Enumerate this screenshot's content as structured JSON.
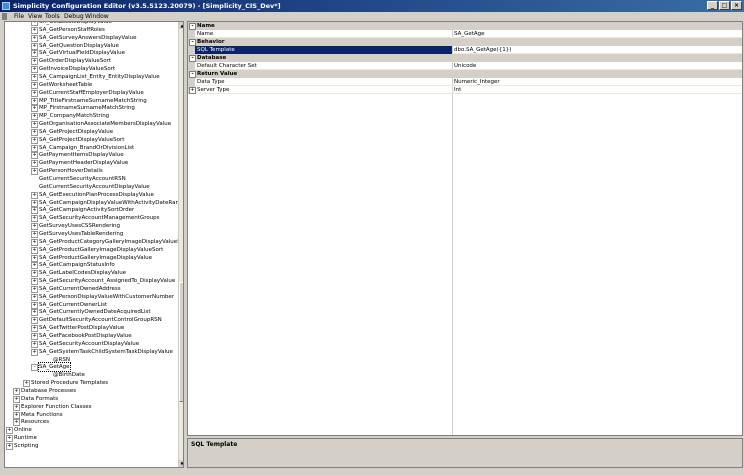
{
  "window": {
    "title": "Simplicity Configuration Editor (v3.5.5123.20079) - [Simplicity_CIS_Dev*]"
  },
  "menu": [
    "File",
    "View",
    "Tools",
    "Debug",
    "Window"
  ],
  "tree": [
    {
      "label": "SA_GetLocaleDisplayValue",
      "indent": 2,
      "exp": "+"
    },
    {
      "label": "SA_GetPersonStaffRoles",
      "indent": 2,
      "exp": "+"
    },
    {
      "label": "SA_GetSurveyAnswersDisplayValue",
      "indent": 2,
      "exp": "+"
    },
    {
      "label": "SA_GetQuestionDisplayValue",
      "indent": 2,
      "exp": "+"
    },
    {
      "label": "SA_GetVirtualFieldDisplayValue",
      "indent": 2,
      "exp": "+"
    },
    {
      "label": "GetOrderDisplayValueSort",
      "indent": 2,
      "exp": "+"
    },
    {
      "label": "GetInvoiceDisplayValueSort",
      "indent": 2,
      "exp": "+"
    },
    {
      "label": "SA_CampaignList_Entity_EntityDisplayValue",
      "indent": 2,
      "exp": "+"
    },
    {
      "label": "GetWorksheetTable",
      "indent": 2,
      "exp": "+"
    },
    {
      "label": "GetCurrentStaffEmployerDisplayValue",
      "indent": 2,
      "exp": "+"
    },
    {
      "label": "MP_TitleFirstnameSurnameMatchString",
      "indent": 2,
      "exp": "+"
    },
    {
      "label": "MP_FirstnameSurnameMatchString",
      "indent": 2,
      "exp": "+"
    },
    {
      "label": "MP_CompanyMatchString",
      "indent": 2,
      "exp": "+"
    },
    {
      "label": "GetOrganisationAssociateMembersDisplayValue",
      "indent": 2,
      "exp": "+"
    },
    {
      "label": "SA_GetProjectDisplayValue",
      "indent": 2,
      "exp": "+"
    },
    {
      "label": "SA_GetProjectDisplayValueSort",
      "indent": 2,
      "exp": "+"
    },
    {
      "label": "SA_Campaign_BrandOrDivisionList",
      "indent": 2,
      "exp": "+"
    },
    {
      "label": "GetPaymentItemsDisplayValue",
      "indent": 2,
      "exp": "+"
    },
    {
      "label": "GetPaymentHeaderDisplayValue",
      "indent": 2,
      "exp": "+"
    },
    {
      "label": "GetPersonHoverDetails",
      "indent": 2,
      "exp": "+"
    },
    {
      "label": "GetCurrentSecurityAccountRSN",
      "indent": 2,
      "exp": ""
    },
    {
      "label": "GetCurrentSecurityAccountDisplayValue",
      "indent": 2,
      "exp": ""
    },
    {
      "label": "SA_GetExecutionPlanProcessDisplayValue",
      "indent": 2,
      "exp": "+"
    },
    {
      "label": "SA_GetCampaignDisplayValueWithActivityDateRange",
      "indent": 2,
      "exp": "+"
    },
    {
      "label": "SA_GetCampaignActivitySortOrder",
      "indent": 2,
      "exp": "+"
    },
    {
      "label": "SA_GetSecurityAccountManagementGroups",
      "indent": 2,
      "exp": "+"
    },
    {
      "label": "GetSurveyUsesCSSRendering",
      "indent": 2,
      "exp": "+"
    },
    {
      "label": "GetSurveyUsesTableRendering",
      "indent": 2,
      "exp": "+"
    },
    {
      "label": "SA_GetProductCategoryGalleryImageDisplayValueSort",
      "indent": 2,
      "exp": "+"
    },
    {
      "label": "SA_GetProductGalleryImageDisplayValueSort",
      "indent": 2,
      "exp": "+"
    },
    {
      "label": "SA_GetProductGalleryImageDisplayValue",
      "indent": 2,
      "exp": "+"
    },
    {
      "label": "SA_GetCampaignStatusInfo",
      "indent": 2,
      "exp": "+"
    },
    {
      "label": "SA_GetLabelCodesDisplayValue",
      "indent": 2,
      "exp": "+"
    },
    {
      "label": "SA_GetSecurityAccount_AssignedTo_DisplayValue",
      "indent": 2,
      "exp": "+"
    },
    {
      "label": "SA_GetCurrentOwnedAddress",
      "indent": 2,
      "exp": "+"
    },
    {
      "label": "SA_GetPersonDisplayValueWithCustomerNumber",
      "indent": 2,
      "exp": "+"
    },
    {
      "label": "SA_GetCurrentOwnerList",
      "indent": 2,
      "exp": "+"
    },
    {
      "label": "SA_GetCurrentlyOwnedDateAcquiredList",
      "indent": 2,
      "exp": "+"
    },
    {
      "label": "GetDefaultSecurityAccountControlGroupRSN",
      "indent": 2,
      "exp": "+"
    },
    {
      "label": "SA_GetTwitterPostDisplayValue",
      "indent": 2,
      "exp": "+"
    },
    {
      "label": "SA_GetFacebookPostDisplayValue",
      "indent": 2,
      "exp": "+"
    },
    {
      "label": "SA_GetSecurityAccountDisplayValue",
      "indent": 2,
      "exp": "+"
    },
    {
      "label": "SA_GetSystemTaskChildSystemTaskDisplayValue",
      "indent": 2,
      "exp": "+"
    },
    {
      "label": "@RSN",
      "indent": 3,
      "exp": ""
    },
    {
      "label": "SA_GetAge",
      "indent": 2,
      "exp": "-",
      "selected": true
    },
    {
      "label": "@BirthDate",
      "indent": 3,
      "exp": ""
    },
    {
      "label": "Stored Procedure Templates",
      "indent": 1,
      "exp": "+"
    },
    {
      "label": "Database Processes",
      "indent": 0,
      "exp": "+"
    },
    {
      "label": "Data Formats",
      "indent": 0,
      "exp": "+"
    },
    {
      "label": "Explorer Function Classes",
      "indent": 0,
      "exp": "+"
    },
    {
      "label": "Meta Functions",
      "indent": 0,
      "exp": "+"
    },
    {
      "label": "Resources",
      "indent": 0,
      "exp": "+"
    },
    {
      "label": "Online",
      "indent": -1,
      "exp": "+"
    },
    {
      "label": "Runtime",
      "indent": -1,
      "exp": "+"
    },
    {
      "label": "Scripting",
      "indent": -1,
      "exp": "+"
    }
  ],
  "properties": [
    {
      "kind": "cat",
      "name": "Name",
      "toggle": "-"
    },
    {
      "kind": "item",
      "name": "Name",
      "value": "SA_GetAge"
    },
    {
      "kind": "cat",
      "name": "Behavior",
      "toggle": "-"
    },
    {
      "kind": "item",
      "name": "SQL Template",
      "value": "dbo.SA_GetAge({1})",
      "selected": true
    },
    {
      "kind": "cat",
      "name": "Database",
      "toggle": "-"
    },
    {
      "kind": "item",
      "name": "Default Character Set",
      "value": "Unicode"
    },
    {
      "kind": "cat",
      "name": "Return Value",
      "toggle": "-"
    },
    {
      "kind": "item",
      "name": "Data Type",
      "value": "Numeric_Integer"
    },
    {
      "kind": "item",
      "name": "Server Type",
      "value": "Int",
      "toggle": "+"
    }
  ],
  "description": {
    "title": "SQL Template"
  }
}
